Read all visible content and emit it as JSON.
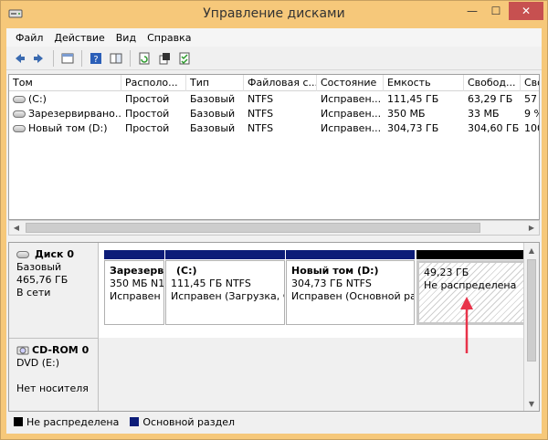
{
  "window": {
    "title": "Управление дисками",
    "controls": {
      "minimize": "—",
      "maximize": "☐",
      "close": "✕"
    }
  },
  "menu": [
    "Файл",
    "Действие",
    "Вид",
    "Справка"
  ],
  "toolbar": [
    "back-arrow-icon",
    "forward-arrow-icon",
    "properties-list-icon",
    "help-icon",
    "help-pane-icon",
    "refresh-icon",
    "settings-icon",
    "checklist-icon"
  ],
  "volumes": {
    "columns": [
      "Том",
      "Располо...",
      "Тип",
      "Файловая с...",
      "Состояние",
      "Емкость",
      "Свобод...",
      "Сво"
    ],
    "rows": [
      [
        "(C:)",
        "Простой",
        "Базовый",
        "NTFS",
        "Исправен...",
        "111,45 ГБ",
        "63,29 ГБ",
        "57"
      ],
      [
        "Зарезервирвано...",
        "Простой",
        "Базовый",
        "NTFS",
        "Исправен...",
        "350 МБ",
        "33 МБ",
        "9 %"
      ],
      [
        "Новый том (D:)",
        "Простой",
        "Базовый",
        "NTFS",
        "Исправен...",
        "304,73 ГБ",
        "304,60 ГБ",
        "100"
      ]
    ]
  },
  "disks": [
    {
      "name": "Диск 0",
      "type": "Базовый",
      "size": "465,76 ГБ",
      "status": "В сети",
      "partitions": [
        {
          "name": "Зарезерв",
          "line1": "350 МБ N1",
          "line2": "Исправен",
          "bar": "blue"
        },
        {
          "name": "(C:)",
          "line1": "111,45 ГБ NTFS",
          "line2": "Исправен (Загрузка, Ф",
          "bar": "blue"
        },
        {
          "name": "Новый том  (D:)",
          "line1": "304,73 ГБ NTFS",
          "line2": "Исправен (Основной раз",
          "bar": "blue"
        },
        {
          "name": "",
          "line1": "49,23 ГБ",
          "line2": "Не распределена",
          "bar": "black"
        }
      ]
    }
  ],
  "cdrom": {
    "name": "CD-ROM 0",
    "drive": "DVD (E:)",
    "media": "Нет носителя"
  },
  "legend": [
    {
      "label": "Не распределена",
      "color": "#000000"
    },
    {
      "label": "Основной раздел",
      "color": "#0c1c78"
    }
  ],
  "colors": {
    "title_bg": "#f6c87a",
    "primary_partition": "#0c1c78",
    "annotation_arrow": "#e8334a"
  }
}
